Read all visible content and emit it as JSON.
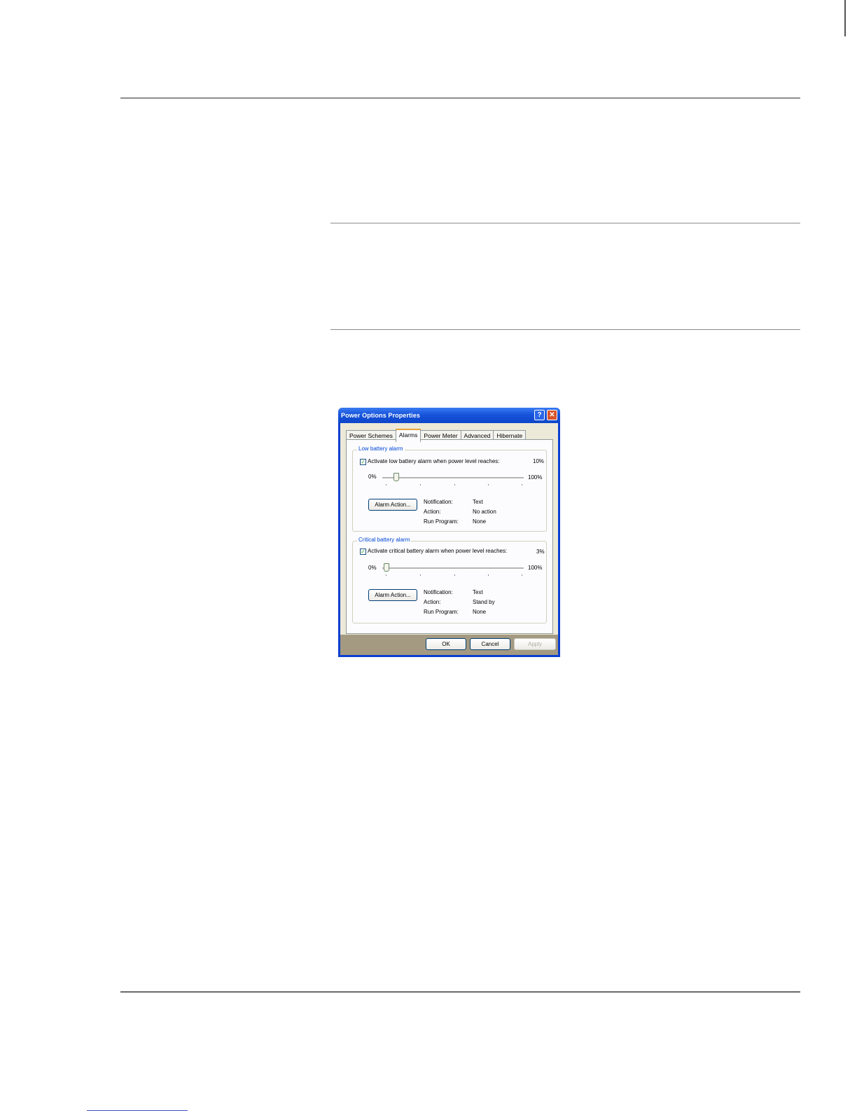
{
  "window": {
    "title": "Power Options Properties",
    "help_glyph": "?",
    "close_glyph": "✕"
  },
  "tabs": [
    {
      "label": "Power Schemes"
    },
    {
      "label": "Alarms",
      "active": true
    },
    {
      "label": "Power Meter"
    },
    {
      "label": "Advanced"
    },
    {
      "label": "Hibernate"
    }
  ],
  "low_alarm": {
    "group_title": "Low battery alarm",
    "checkbox_label": "Activate low battery alarm when power level reaches:",
    "checked": true,
    "level_text": "10%",
    "level_value": 10,
    "min_label": "0%",
    "max_label": "100%",
    "button_label": "Alarm Action...",
    "notification_label": "Notification:",
    "notification_value": "Text",
    "action_label": "Action:",
    "action_value": "No action",
    "program_label": "Run Program:",
    "program_value": "None"
  },
  "critical_alarm": {
    "group_title": "Critical battery alarm",
    "checkbox_label": "Activate critical battery alarm when power level reaches:",
    "checked": true,
    "level_text": "3%",
    "level_value": 3,
    "min_label": "0%",
    "max_label": "100%",
    "button_label": "Alarm Action...",
    "notification_label": "Notification:",
    "notification_value": "Text",
    "action_label": "Action:",
    "action_value": "Stand by",
    "program_label": "Run Program:",
    "program_value": "None"
  },
  "buttons": {
    "ok": "OK",
    "cancel": "Cancel",
    "apply": "Apply"
  },
  "colors": {
    "titlebar": "#1654db",
    "dialog_bg": "#ece9d8",
    "group_title": "#0046d5",
    "close_button": "#d8542a"
  }
}
